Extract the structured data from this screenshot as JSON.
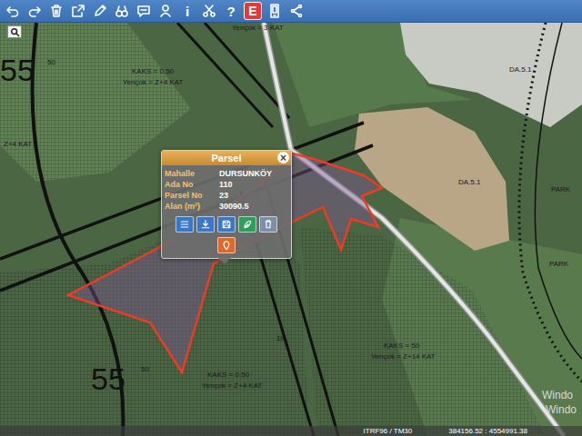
{
  "toolbar": {
    "items": [
      {
        "kind": "icon"
      },
      {
        "kind": "icon"
      },
      {
        "kind": "icon"
      },
      {
        "kind": "icon"
      },
      {
        "kind": "icon"
      },
      {
        "kind": "icon"
      },
      {
        "kind": "icon"
      },
      {
        "kind": "icon"
      },
      {
        "kind": "glyph",
        "label": "i"
      },
      {
        "kind": "icon"
      },
      {
        "kind": "glyph",
        "label": "?"
      },
      {
        "kind": "badge",
        "label": "E"
      },
      {
        "kind": "icon"
      },
      {
        "kind": "icon"
      }
    ]
  },
  "map": {
    "labels": [
      {
        "text": "55",
        "kind": "zone"
      },
      {
        "text": "50",
        "kind": "note"
      },
      {
        "text": "Yençok = 3 KAT",
        "kind": "note"
      },
      {
        "text": "KAKS = 0.50",
        "kind": "note"
      },
      {
        "text": "Yençok = Z+4 KAT",
        "kind": "note"
      },
      {
        "text": "Z+4 KAT",
        "kind": "note"
      },
      {
        "text": "55",
        "kind": "zone"
      },
      {
        "text": "50",
        "kind": "note"
      },
      {
        "text": "KAKS = 0.50",
        "kind": "note"
      },
      {
        "text": "Yençok = Z+4 KAT",
        "kind": "note"
      },
      {
        "text": "19",
        "kind": "note"
      },
      {
        "text": "KAKS = 50",
        "kind": "note"
      },
      {
        "text": "Yençok = Z+14 KAT",
        "kind": "note"
      },
      {
        "text": "DA.5.1",
        "kind": "note"
      },
      {
        "text": "DA.5.1",
        "kind": "note"
      },
      {
        "text": "PARK",
        "kind": "note"
      },
      {
        "text": "PARK",
        "kind": "note"
      },
      {
        "text": "Windo",
        "kind": "watermark"
      },
      {
        "text": "Windo",
        "kind": "watermark"
      }
    ]
  },
  "popup": {
    "title": "Parsel",
    "close": "×",
    "fields": [
      {
        "label": "Mahalle",
        "value": "DURSUNKÖY"
      },
      {
        "label": "Ada No",
        "value": "110"
      },
      {
        "label": "Parsel No",
        "value": "23"
      },
      {
        "label": "Alan (m²)",
        "value": "30090.5"
      }
    ],
    "buttons": [
      {
        "color": "#3a77c9"
      },
      {
        "color": "#3a77c9"
      },
      {
        "color": "#3a77c9"
      },
      {
        "color": "#2f9e5a"
      },
      {
        "color": "#7d8ea8"
      },
      {
        "color": "#e0692a"
      }
    ]
  },
  "status_bar": {
    "projection": "ITRF96 / TM30",
    "coordinates": "384156.52 : 4554991.38"
  }
}
